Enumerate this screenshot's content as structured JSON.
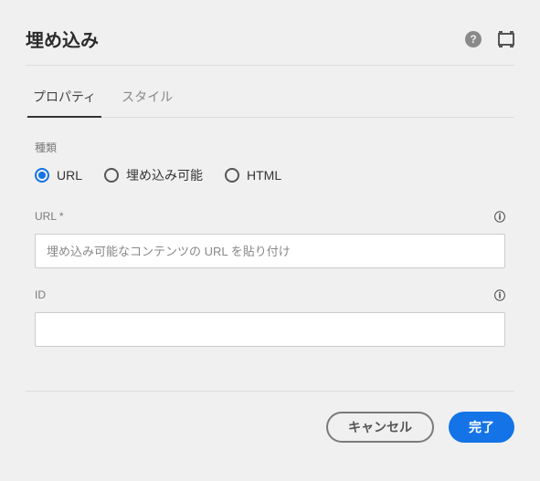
{
  "header": {
    "title": "埋め込み"
  },
  "tabs": {
    "properties": "プロパティ",
    "styles": "スタイル"
  },
  "typeField": {
    "label": "種類",
    "options": {
      "url": "URL",
      "embeddable": "埋め込み可能",
      "html": "HTML"
    }
  },
  "urlField": {
    "label": "URL *",
    "placeholder": "埋め込み可能なコンテンツの URL を貼り付け",
    "value": ""
  },
  "idField": {
    "label": "ID",
    "value": ""
  },
  "footer": {
    "cancel": "キャンセル",
    "done": "完了"
  }
}
